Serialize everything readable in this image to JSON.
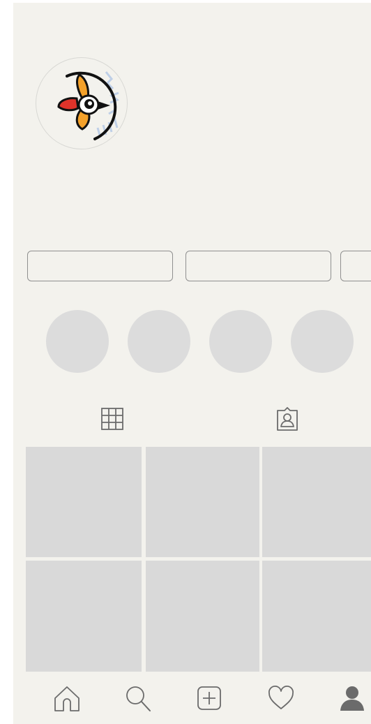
{
  "profile": {
    "avatar_icon": "bird-logo-icon"
  },
  "action_buttons": [
    {
      "name": "action-button-1",
      "label": ""
    },
    {
      "name": "action-button-2",
      "label": ""
    },
    {
      "name": "action-button-3",
      "label": ""
    }
  ],
  "highlights": [
    {
      "label": ""
    },
    {
      "label": ""
    },
    {
      "label": ""
    },
    {
      "label": ""
    }
  ],
  "tabs": [
    {
      "icon": "grid-icon",
      "selected": true
    },
    {
      "icon": "tagged-person-icon",
      "selected": false
    }
  ],
  "bottom_nav": [
    {
      "icon": "home-icon"
    },
    {
      "icon": "search-icon"
    },
    {
      "icon": "add-post-icon"
    },
    {
      "icon": "heart-icon"
    },
    {
      "icon": "profile-icon"
    }
  ],
  "colors": {
    "background": "#f3f2ed",
    "placeholder": "#d9d9d9",
    "icon": "#6b6b6b",
    "logo_orange": "#f4a12a",
    "logo_red": "#e0332a"
  }
}
